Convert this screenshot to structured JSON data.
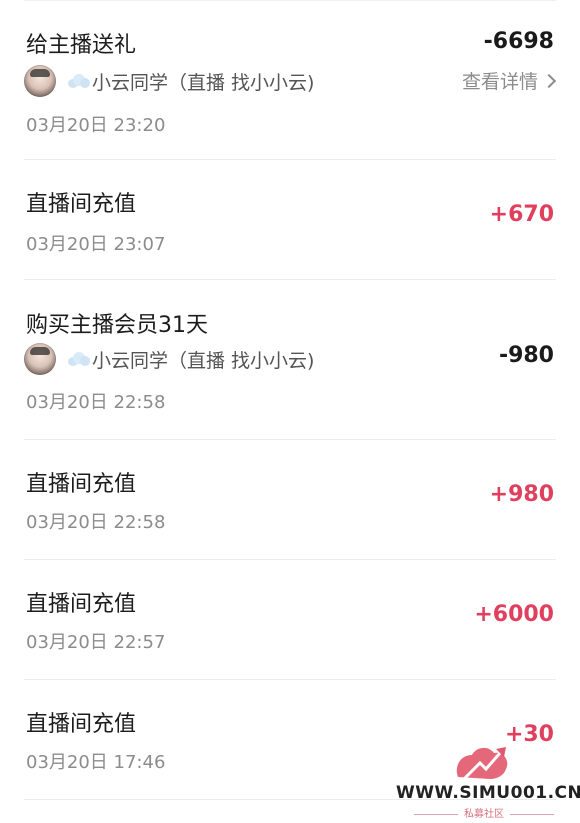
{
  "transactions": [
    {
      "title": "给主播送礼",
      "amount": "-6698",
      "anchor_name": "小云同学（直播 找小小云)",
      "detail_label": "查看详情",
      "time": "03月20日 23:20"
    },
    {
      "title": "直播间充值",
      "amount": "+670",
      "time": "03月20日 23:07"
    },
    {
      "title": "购买主播会员31天",
      "amount": "-980",
      "anchor_name": "小云同学（直播 找小小云)",
      "time": "03月20日 22:58"
    },
    {
      "title": "直播间充值",
      "amount": "+980",
      "time": "03月20日 22:58"
    },
    {
      "title": "直播间充值",
      "amount": "+6000",
      "time": "03月20日 22:57"
    },
    {
      "title": "直播间充值",
      "amount": "+30",
      "time": "03月20日 17:46"
    }
  ],
  "watermark": {
    "site": "WWW.SIMU001.CN",
    "subtitle": "私募社区"
  },
  "colors": {
    "positive": "#e0405e",
    "negative": "#1a1a1a",
    "muted": "#8c8c8c"
  },
  "icons": {
    "avatar": "anchor-avatar",
    "cloud": "cloud-icon",
    "chevron": "chevron-right-icon",
    "logo": "simu-logo"
  }
}
